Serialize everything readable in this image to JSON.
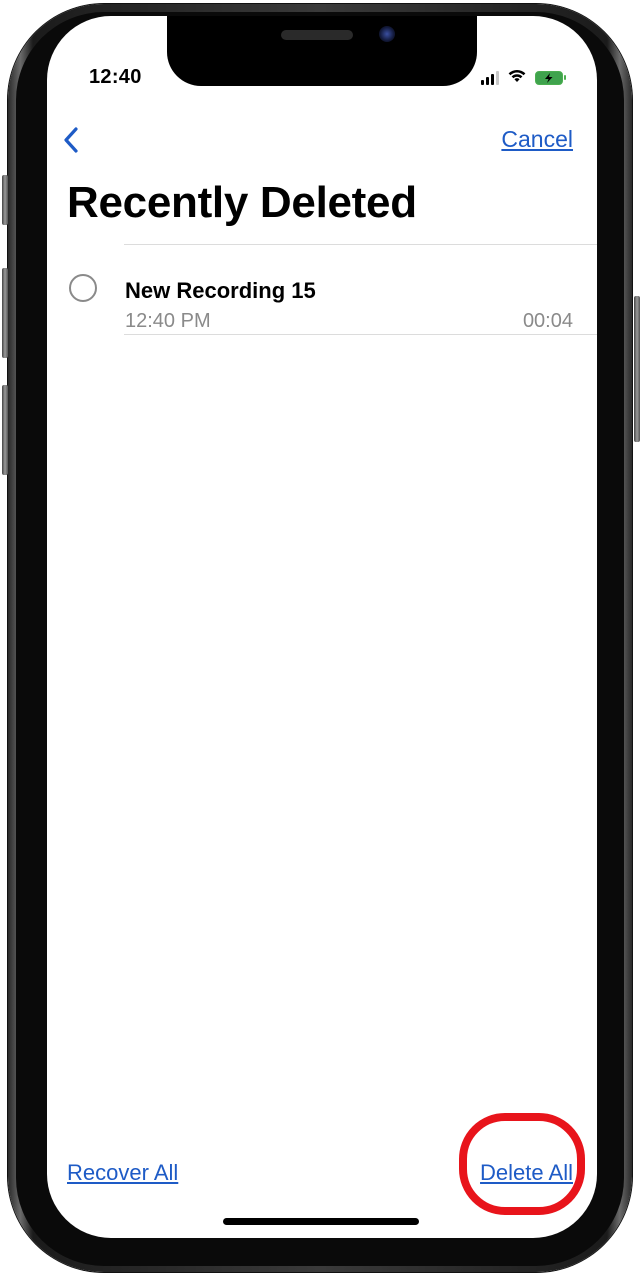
{
  "status_bar": {
    "time": "12:40",
    "icons": [
      "signal-icon",
      "wifi-icon",
      "battery-charging-icon"
    ]
  },
  "nav": {
    "back_icon": "chevron-left-icon",
    "cancel_label": "Cancel"
  },
  "page": {
    "title": "Recently Deleted"
  },
  "recordings": [
    {
      "title": "New Recording 15",
      "time": "12:40 PM",
      "duration": "00:04",
      "selected": false
    }
  ],
  "toolbar": {
    "recover_all_label": "Recover All",
    "delete_all_label": "Delete All"
  },
  "annotation": {
    "highlight_target": "Delete All",
    "highlight_color": "#e8141b"
  },
  "colors": {
    "accent": "#1e5bc6",
    "secondary_text": "#8a8a8a",
    "battery": "#3fa34d"
  }
}
